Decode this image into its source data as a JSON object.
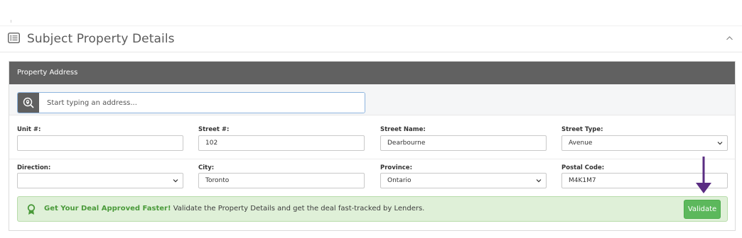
{
  "section": {
    "title": "Subject Property Details",
    "icon": "list-icon",
    "collapse_icon": "chevron-up-icon"
  },
  "panel": {
    "header": "Property Address",
    "search": {
      "icon": "search-location-icon",
      "placeholder": "Start typing an address...",
      "value": ""
    }
  },
  "fields": {
    "unit": {
      "label": "Unit #:",
      "value": ""
    },
    "street_number": {
      "label": "Street #:",
      "value": "102"
    },
    "street_name": {
      "label": "Street Name:",
      "value": "Dearbourne"
    },
    "street_type": {
      "label": "Street Type:",
      "value": "Avenue"
    },
    "direction": {
      "label": "Direction:",
      "value": ""
    },
    "city": {
      "label": "City:",
      "value": "Toronto"
    },
    "province": {
      "label": "Province:",
      "value": "Ontario"
    },
    "postal_code": {
      "label": "Postal Code:",
      "value": "M4K1M7"
    }
  },
  "banner": {
    "icon": "award-icon",
    "strong_text": "Get Your Deal Approved Faster!",
    "text": " Validate the Property Details and get the deal fast-tracked by Lenders.",
    "button_label": "Validate"
  },
  "colors": {
    "panel_header_bg": "#616161",
    "banner_bg": "#dff0d8",
    "validate_button": "#5cb85c",
    "arrow": "#5a2d82"
  }
}
